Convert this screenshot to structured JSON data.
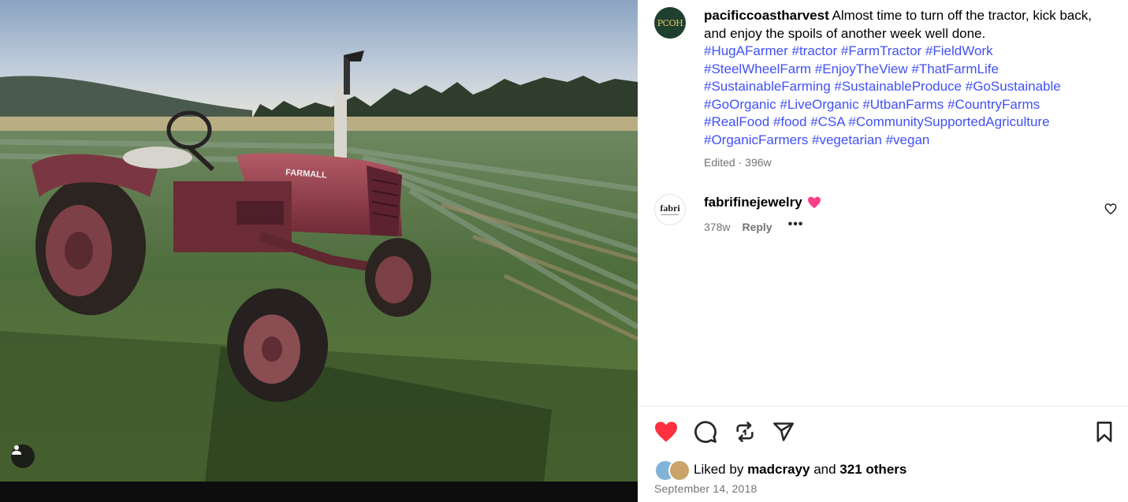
{
  "post": {
    "author": "pacificcoastharvest",
    "author_avatar_text": "PCOH",
    "caption_text": "Almost time to turn off the tractor, kick back, and enjoy the spoils of another week well done.",
    "hashtags": [
      "#HugAFarmer",
      "#tractor",
      "#FarmTractor",
      "#FieldWork",
      "#SteelWheelFarm",
      "#EnjoyTheView",
      "#ThatFarmLife",
      "#SustainableFarming",
      "#SustainableProduce",
      "#GoSustainable",
      "#GoOrganic",
      "#LiveOrganic",
      "#UtbanFarms",
      "#CountryFarms",
      "#RealFood",
      "#food",
      "#CSA",
      "#CommunitySupportedAgriculture",
      "#OrganicFarmers",
      "#vegetarian",
      "#vegan"
    ],
    "edited_label": "Edited",
    "edited_separator": "·",
    "edited_age": "396w",
    "photo_decal_text": "FARMALL"
  },
  "comment": {
    "username": "fabrifinejewelry",
    "avatar_text": "fabri",
    "emoji_icon": "pink-heart-emoji",
    "age": "378w",
    "reply_label": "Reply",
    "more_label": "•••"
  },
  "likes": {
    "prefix": "Liked by",
    "first_user": "madcrayy",
    "joiner": "and",
    "others": "321 others"
  },
  "date": "September 14, 2018",
  "colors": {
    "hashtag": "#4150f7",
    "liked_heart": "#ff3040",
    "muted_text": "#737373",
    "divider": "#efefef"
  },
  "icons": {
    "like": "heart-filled-icon",
    "comment": "comment-bubble-icon",
    "repost": "repost-icon",
    "share": "paper-plane-icon",
    "save": "bookmark-icon",
    "tag_user": "user-tag-icon"
  }
}
